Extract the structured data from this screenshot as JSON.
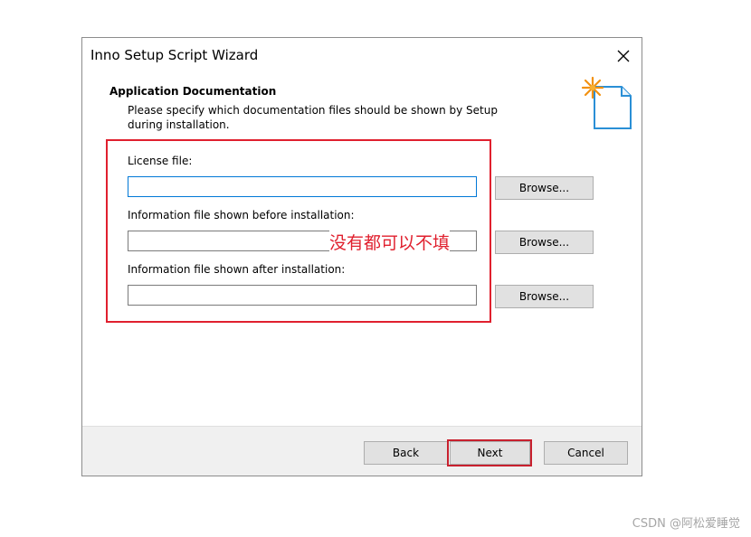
{
  "window": {
    "title": "Inno Setup Script Wizard",
    "close_icon": "close-icon"
  },
  "page": {
    "heading": "Application Documentation",
    "description": "Please specify which documentation files should be shown by Setup during installation.",
    "icon": "wizard-document-sparkle-icon"
  },
  "fields": {
    "license": {
      "label": "License file:",
      "value": "",
      "browse_label": "Browse..."
    },
    "before": {
      "label": "Information file shown before installation:",
      "value": "",
      "browse_label": "Browse..."
    },
    "after": {
      "label": "Information file shown after installation:",
      "value": "",
      "browse_label": "Browse..."
    }
  },
  "annotation": {
    "text": "没有都可以不填",
    "color": "#e0202e"
  },
  "footer": {
    "back_label": "Back",
    "next_label": "Next",
    "cancel_label": "Cancel"
  },
  "watermark": "CSDN @阿松爱睡觉",
  "colors": {
    "accent": "#0078d7",
    "annotation_red": "#e0202e",
    "button_face": "#e1e1e1",
    "panel": "#f0f0f0"
  }
}
